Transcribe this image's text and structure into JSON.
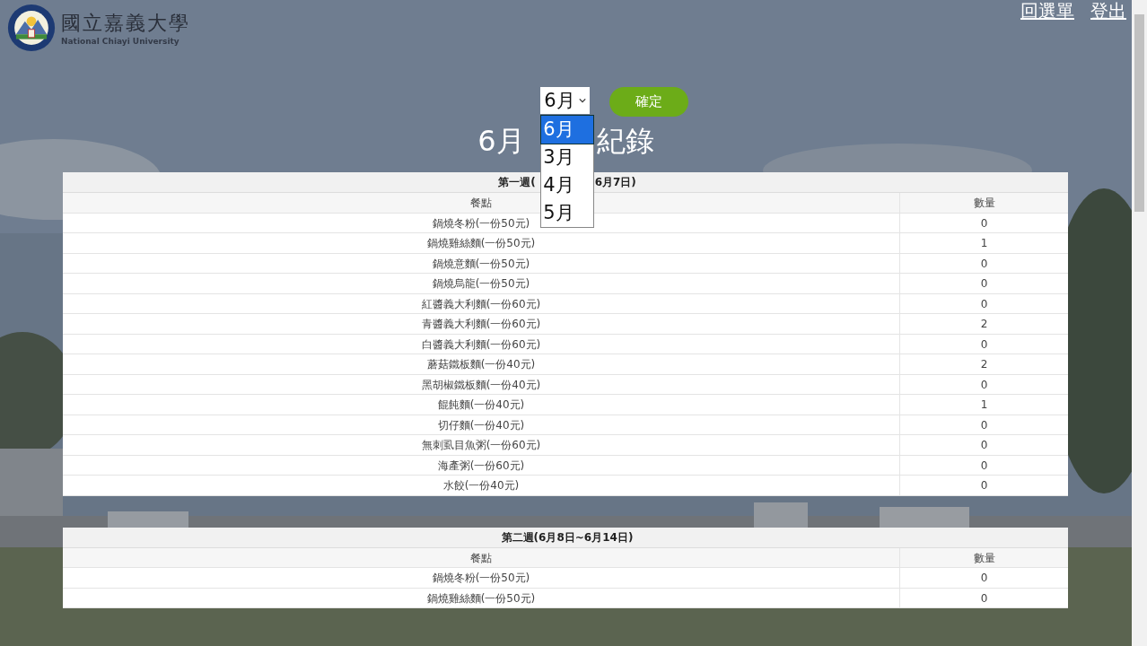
{
  "header": {
    "logo_name": "國立嘉義大學",
    "logo_subtitle": "National Chiayi University",
    "links": [
      "回選單",
      "登出"
    ]
  },
  "month_select": {
    "value": "6月",
    "options": [
      {
        "label": "6月",
        "selected": true
      },
      {
        "label": "3月",
        "selected": false
      },
      {
        "label": "4月",
        "selected": false
      },
      {
        "label": "5月",
        "selected": false
      }
    ],
    "expanded": true
  },
  "confirm_button": "確定",
  "title_parts": [
    "6月",
    "紀錄"
  ],
  "weeks": [
    {
      "title_parts": [
        "第一週(",
        "6月7日)"
      ],
      "columns": [
        "餐點",
        "數量"
      ],
      "rows": [
        [
          "鍋燒冬粉(一份50元)",
          "0"
        ],
        [
          "鍋燒雞絲麵(一份50元)",
          "1"
        ],
        [
          "鍋燒意麵(一份50元)",
          "0"
        ],
        [
          "鍋燒烏龍(一份50元)",
          "0"
        ],
        [
          "紅醬義大利麵(一份60元)",
          "0"
        ],
        [
          "青醬義大利麵(一份60元)",
          "2"
        ],
        [
          "白醬義大利麵(一份60元)",
          "0"
        ],
        [
          "蘑菇鐵板麵(一份40元)",
          "2"
        ],
        [
          "黑胡椒鐵板麵(一份40元)",
          "0"
        ],
        [
          "餛飩麵(一份40元)",
          "1"
        ],
        [
          "切仔麵(一份40元)",
          "0"
        ],
        [
          "無刺虱目魚粥(一份60元)",
          "0"
        ],
        [
          "海產粥(一份60元)",
          "0"
        ],
        [
          "水餃(一份40元)",
          "0"
        ]
      ]
    },
    {
      "title_parts": [
        "第二週(6月8日~6月14日)"
      ],
      "columns": [
        "餐點",
        "數量"
      ],
      "rows": [
        [
          "鍋燒冬粉(一份50元)",
          "0"
        ],
        [
          "鍋燒雞絲麵(一份50元)",
          "0"
        ]
      ]
    }
  ]
}
